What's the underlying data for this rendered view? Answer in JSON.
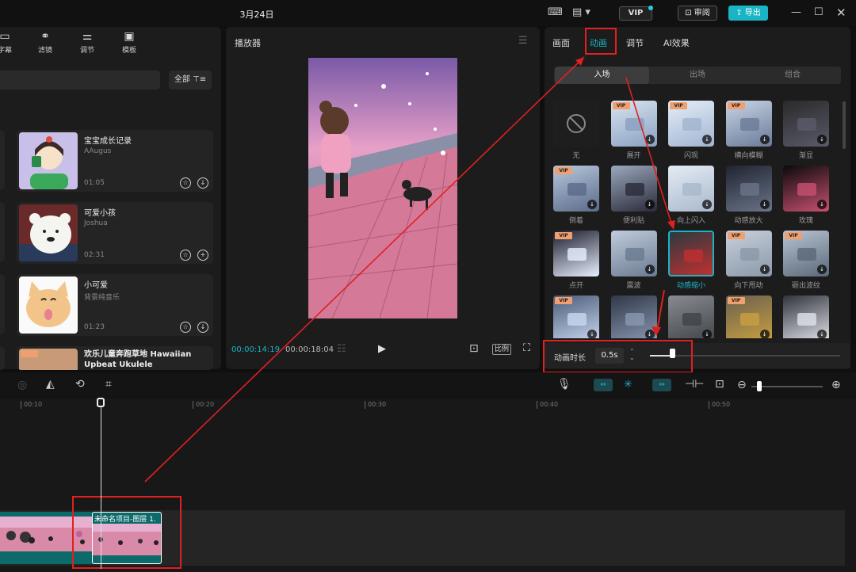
{
  "titlebar": {
    "title": "3月24日",
    "vip_label": "VIP",
    "review_label": "审阅",
    "export_label": "导出"
  },
  "library": {
    "tabs": [
      {
        "label": "字幕",
        "icon": "caption-icon"
      },
      {
        "label": "滤镜",
        "icon": "filter-icon"
      },
      {
        "label": "调节",
        "icon": "adjust-icon"
      },
      {
        "label": "模板",
        "icon": "template-icon"
      }
    ],
    "filter_label": "全部",
    "cards": [
      {
        "title": "宝宝成长记录",
        "author": "AAugus",
        "duration": "01:05"
      },
      {
        "title": "可爱小孩",
        "author": "Joshua",
        "duration": "02:31"
      },
      {
        "title": "小可爱",
        "author": "背景纯音乐",
        "duration": "01:23"
      },
      {
        "title": "欢乐儿童奔跑草地 Hawaiian Upbeat Ukulele",
        "author": "",
        "duration": ""
      }
    ]
  },
  "player": {
    "title": "播放器",
    "current_time": "00:00:14:19",
    "total_time": "00:00:18:04",
    "ratio_label": "比例"
  },
  "props": {
    "tabs": [
      "画面",
      "动画",
      "调节",
      "AI效果"
    ],
    "active_tab": "动画",
    "subtabs": [
      "入场",
      "出场",
      "组合"
    ],
    "active_subtab": "入场",
    "animations": [
      {
        "label": "无",
        "vip": false
      },
      {
        "label": "展开",
        "vip": true
      },
      {
        "label": "闪现",
        "vip": true
      },
      {
        "label": "横向模糊",
        "vip": true
      },
      {
        "label": "渐显",
        "vip": false
      },
      {
        "label": "倒着",
        "vip": true
      },
      {
        "label": "便利贴",
        "vip": false
      },
      {
        "label": "向上闪入",
        "vip": false
      },
      {
        "label": "动感放大",
        "vip": false
      },
      {
        "label": "玫瑰",
        "vip": false
      },
      {
        "label": "点开",
        "vip": true
      },
      {
        "label": "震波",
        "vip": false
      },
      {
        "label": "动感缩小",
        "vip": false
      },
      {
        "label": "向下甩动",
        "vip": true
      },
      {
        "label": "砸出波纹",
        "vip": true
      },
      {
        "label": "",
        "vip": true
      },
      {
        "label": "",
        "vip": false
      },
      {
        "label": "",
        "vip": false
      },
      {
        "label": "",
        "vip": true
      },
      {
        "label": "",
        "vip": false
      }
    ],
    "duration_label": "动画时长",
    "duration_value": "0.5s"
  },
  "timeline": {
    "ruler": [
      "00:10",
      "00:20",
      "00:30",
      "00:40",
      "00:50"
    ],
    "clip_label": "未命名项目-图层 1."
  },
  "colors": {
    "accent": "#19b5c4",
    "highlight": "#e02020"
  }
}
